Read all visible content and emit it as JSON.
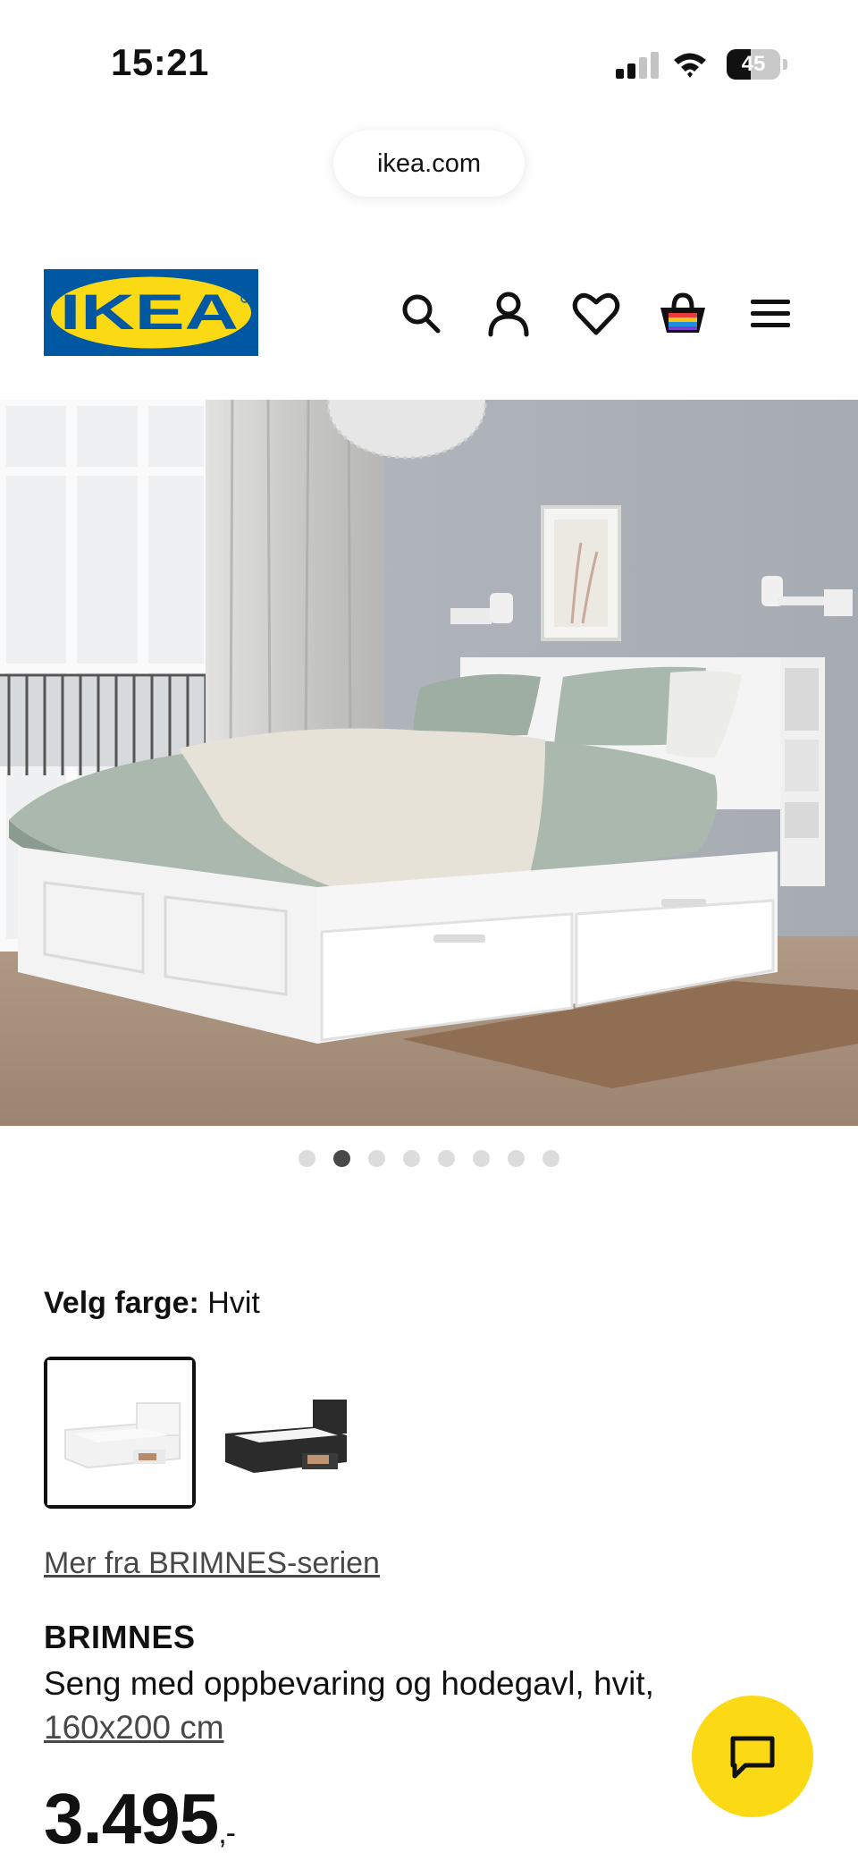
{
  "status_bar": {
    "time": "15:21",
    "battery": "45",
    "battery_level": 0.45
  },
  "browser": {
    "url": "ikea.com"
  },
  "header": {
    "logo_text": "IKEA",
    "brand_colors": {
      "blue": "#0058a3",
      "yellow": "#fbd914"
    },
    "icons": [
      "search-icon",
      "profile-icon",
      "heart-icon",
      "shopping-bag-icon",
      "menu-icon"
    ]
  },
  "gallery": {
    "image_count": 8,
    "active_index": 1
  },
  "color_selector": {
    "label": "Velg farge:",
    "value": "Hvit",
    "options": [
      {
        "name": "Hvit",
        "selected": true
      },
      {
        "name": "Svart",
        "selected": false
      }
    ]
  },
  "product": {
    "series_link": "Mer fra BRIMNES-serien",
    "name": "BRIMNES",
    "description": "Seng med oppbevaring og hodegavl, hvit,",
    "size": "160x200 cm",
    "price": "3.495",
    "price_suffix": ",-"
  },
  "chat": {
    "icon": "chat-icon",
    "color": "#fbd914"
  }
}
